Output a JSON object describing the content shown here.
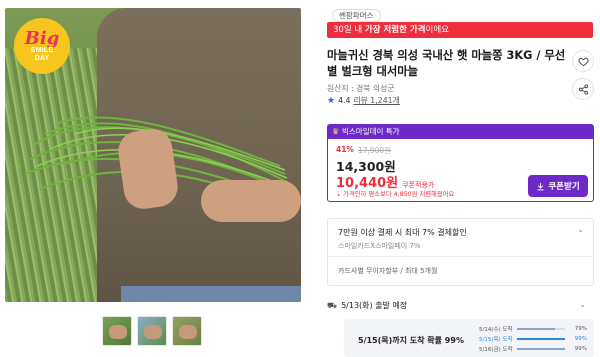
{
  "image_badge": {
    "line1": "Big",
    "line2": "SMILE",
    "line3": "DAY"
  },
  "seller": "쎈팜파머스",
  "banner": {
    "pre": "30일 내 ",
    "bold": "가장 저렴한 가격",
    "post": "이에요"
  },
  "title": "마늘귀신 경북 의성 국내산 햇 마늘쫑 3KG / 무선별 벌크형 대서마늘",
  "origin": "원산지 : 경북 의성군",
  "rating": {
    "score": "4.4",
    "reviews": "리뷰 1,241개"
  },
  "price": {
    "header": "빅스마일데이 특가",
    "discount": "41%",
    "original": "17,900원",
    "sale": "14,300원",
    "coupon_price": "10,440원",
    "coupon_note": "쿠폰적용가",
    "lowest_note": "가격인하 평소보다 4,850원 저렴해졌어요",
    "coupon_button": "쿠폰받기"
  },
  "card": {
    "promo": "7만원 이상 결제 시 최대 7% 결제할인",
    "sub": "스마일카드X스마일페이 7%",
    "installment": "카드사별 무이자할부 / 최대 5개월"
  },
  "shipping": {
    "date": "5/13(화) 출발 예정",
    "prediction": "5/15(목)까지 도착 확률 99%",
    "items": [
      {
        "label": "5/14(수) 도착",
        "percent": "79%",
        "value": 0.79
      },
      {
        "label": "5/15(목) 도착",
        "percent": "99%",
        "value": 0.99
      },
      {
        "label": "5/16(금) 도착",
        "percent": "99%",
        "value": 0.99
      }
    ]
  }
}
